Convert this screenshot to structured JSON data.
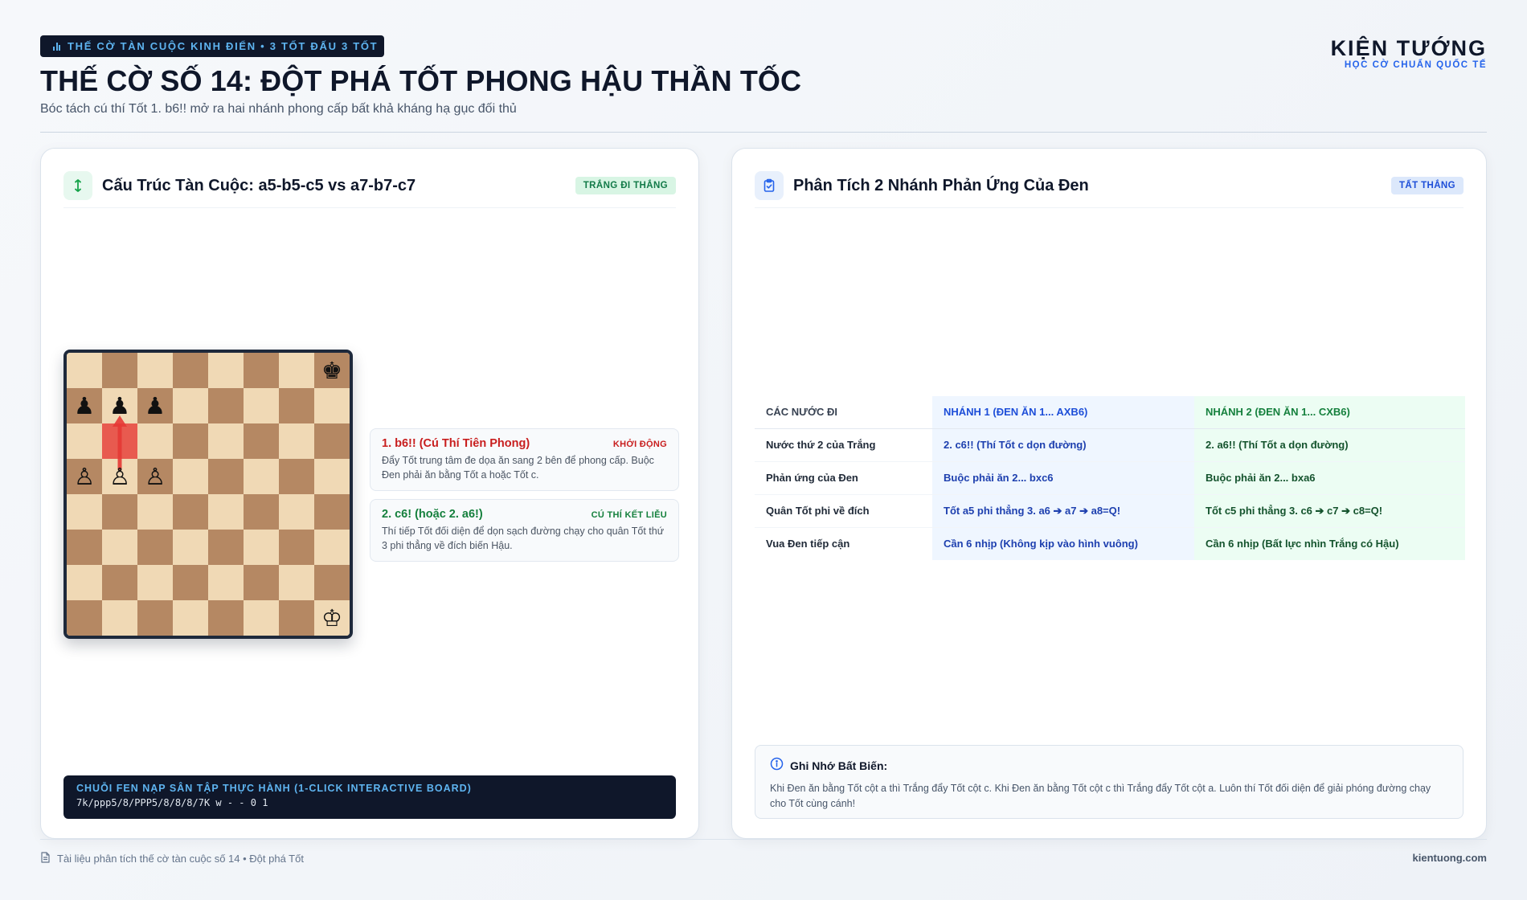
{
  "header": {
    "tag": "THẾ CỜ TÀN CUỘC KINH ĐIỂN • 3 TỐT ĐẤU 3 TỐT",
    "title": "THẾ CỜ SỐ 14: ĐỘT PHÁ TỐT PHONG HẬU THẦN TỐC",
    "subtitle": "Bóc tách cú thí Tốt 1. b6!! mở ra hai nhánh phong cấp bất khả kháng hạ gục đối thủ"
  },
  "brand": {
    "name": "KIỆN TƯỚNG",
    "tagline": "HỌC CỜ CHUẨN QUỐC TẾ"
  },
  "left_card": {
    "icon": "arrows-vertical-icon",
    "title": "Cấu Trúc Tàn Cuộc: a5-b5-c5 vs a7-b7-c7",
    "badge": "TRẮNG ĐI THẮNG",
    "board": {
      "fen": "7k/ppp5/8/PPP5/8/8/8/7K w - - 0 1",
      "light_square": "#f0d9b5",
      "dark_square": "#b58863",
      "highlight_square": "#e85a4f",
      "arrow_color": "#e53935",
      "pieces": [
        {
          "piece": "black-king",
          "glyph": "♚",
          "square": "h8"
        },
        {
          "piece": "black-pawn",
          "glyph": "♟",
          "square": "a7"
        },
        {
          "piece": "black-pawn",
          "glyph": "♟",
          "square": "b7"
        },
        {
          "piece": "black-pawn",
          "glyph": "♟",
          "square": "c7"
        },
        {
          "piece": "white-pawn",
          "glyph": "♙",
          "square": "a5"
        },
        {
          "piece": "white-pawn",
          "glyph": "♙",
          "square": "b5"
        },
        {
          "piece": "white-pawn",
          "glyph": "♙",
          "square": "c5"
        },
        {
          "piece": "white-king",
          "glyph": "♔",
          "square": "h1"
        }
      ],
      "highlight": "b6",
      "arrow": {
        "from": "b5",
        "to": "b7"
      }
    },
    "moves": [
      {
        "title": "1. b6!! (Cú Thí Tiên Phong)",
        "tag": "KHỞI ĐỘNG",
        "desc": "Đẩy Tốt trung tâm đe dọa ăn sang 2 bên để phong cấp. Buộc Đen phải ăn bằng Tốt a hoặc Tốt c."
      },
      {
        "title": "2. c6! (hoặc 2. a6!)",
        "tag": "CÚ THÍ KẾT LIỄU",
        "desc": "Thí tiếp Tốt đối diện để dọn sạch đường chạy cho quân Tốt thứ 3 phi thẳng về đích biến Hậu."
      }
    ],
    "fen_label": "CHUỖI FEN NẠP SÂN TẬP THỰC HÀNH (1-CLICK INTERACTIVE BOARD)",
    "fen": "7k/ppp5/8/PPP5/8/8/8/7K w - - 0 1"
  },
  "right_card": {
    "icon": "clipboard-check-icon",
    "title": "Phân Tích 2 Nhánh Phản Ứng Của Đen",
    "badge": "TẤT THẮNG",
    "table": {
      "headers": [
        "CÁC NƯỚC ĐI",
        "NHÁNH 1 (ĐEN ĂN 1... AXB6)",
        "NHÁNH 2 (ĐEN ĂN 1... CXB6)"
      ],
      "rows": [
        {
          "label": "Nước thứ 2 của Trắng",
          "b1": "2. c6!! (Thí Tốt c dọn đường)",
          "b2": "2. a6!! (Thí Tốt a dọn đường)"
        },
        {
          "label": "Phản ứng của Đen",
          "b1": "Buộc phải ăn 2... bxc6",
          "b2": "Buộc phải ăn 2... bxa6"
        },
        {
          "label": "Quân Tốt phi về đích",
          "b1": "Tốt a5 phi thẳng 3. a6 ➔ a7 ➔ a8=Q!",
          "b2": "Tốt c5 phi thẳng 3. c6 ➔ c7 ➔ c8=Q!"
        },
        {
          "label": "Vua Đen tiếp cận",
          "b1": "Cần 6 nhịp (Không kịp vào hình vuông)",
          "b2": "Cần 6 nhịp (Bất lực nhìn Trắng có Hậu)"
        }
      ]
    },
    "remember": {
      "icon": "info-circle-icon",
      "title": "Ghi Nhớ Bất Biến:",
      "text": "Khi Đen ăn bằng Tốt cột a thì Trắng đẩy Tốt cột c. Khi Đen ăn bằng Tốt cột c thì Trắng đẩy Tốt cột a. Luôn thí Tốt đối diện để giải phóng đường chạy cho Tốt cùng cánh!"
    }
  },
  "footer": {
    "icon": "document-icon",
    "left": "Tài liệu phân tích thế cờ tàn cuộc số 14 • Đột phá Tốt",
    "right": "kientuong.com"
  },
  "colors": {
    "navy": "#0f172a",
    "accent_blue": "#2563eb",
    "accent_green": "#15803d",
    "accent_red": "#c81e1e"
  }
}
